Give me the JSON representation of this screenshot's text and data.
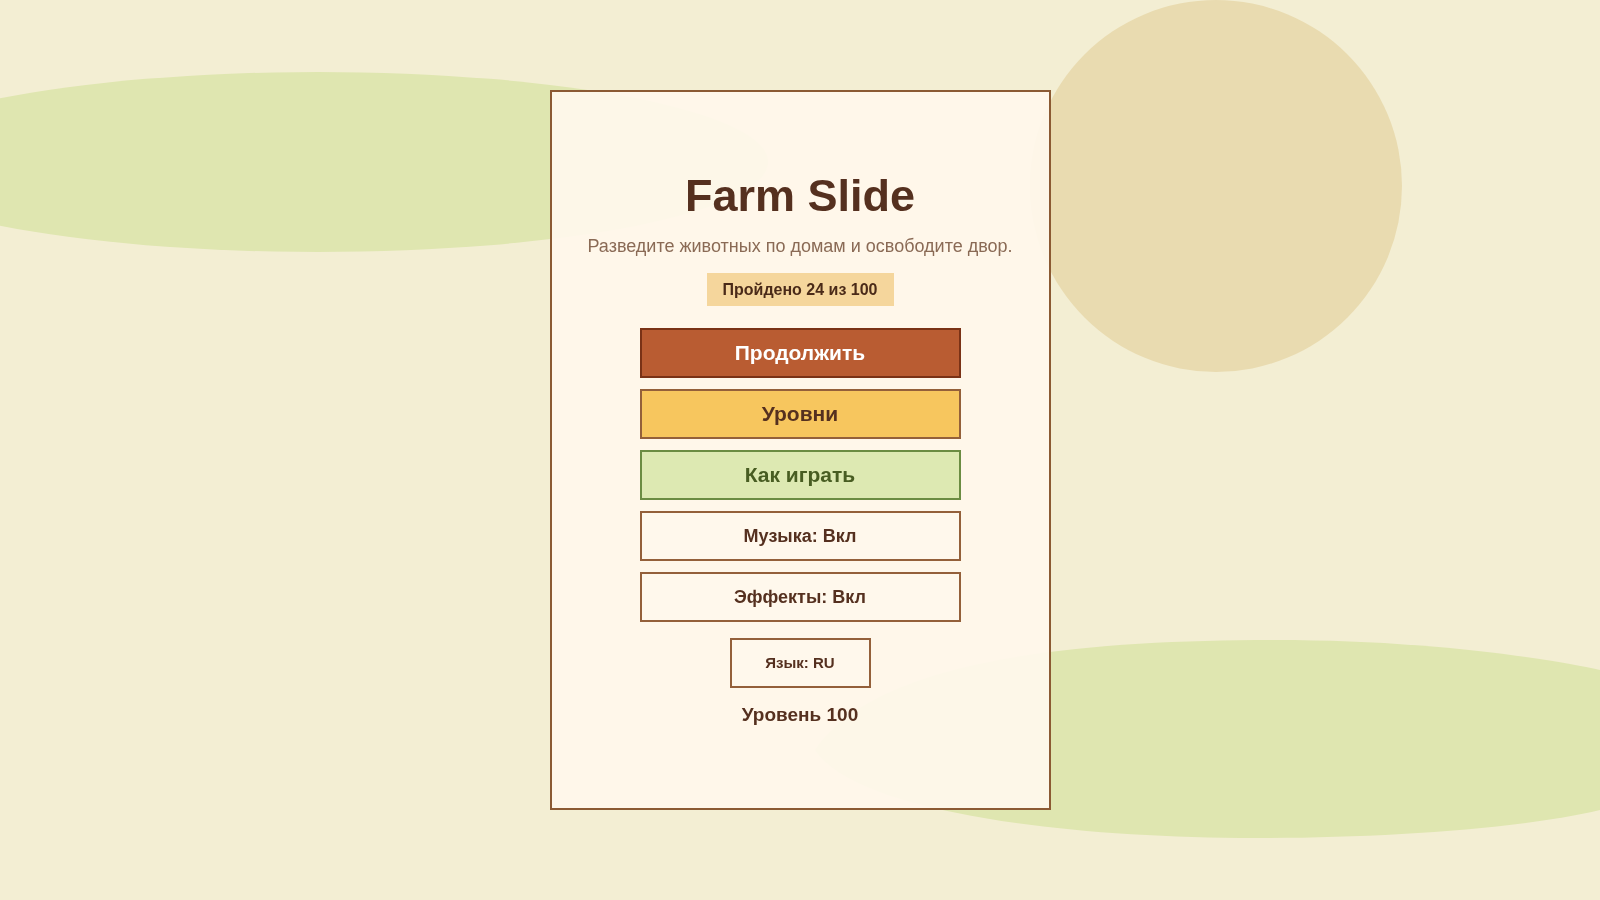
{
  "title": "Farm Slide",
  "subtitle": "Разведите животных по домам и освободите двор.",
  "progress_badge": "Пройдено 24 из 100",
  "menu_buttons": [
    {
      "label": "Продолжить",
      "kind": "primary"
    },
    {
      "label": "Уровни",
      "kind": "secondary"
    },
    {
      "label": "Как играть",
      "kind": "help"
    },
    {
      "label": "Музыка: Вкл",
      "kind": "toggle"
    },
    {
      "label": "Эффекты: Вкл",
      "kind": "toggle"
    }
  ],
  "language_button": "Язык: RU",
  "level_label": "Уровень 100"
}
